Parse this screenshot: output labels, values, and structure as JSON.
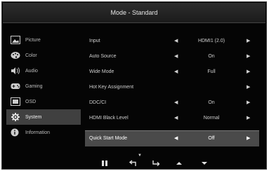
{
  "title": "Mode - Standard",
  "sidebar": {
    "items": [
      {
        "label": "Picture",
        "icon": "picture-icon"
      },
      {
        "label": "Color",
        "icon": "palette-icon"
      },
      {
        "label": "Audio",
        "icon": "speaker-icon"
      },
      {
        "label": "Gaming",
        "icon": "gamepad-icon"
      },
      {
        "label": "OSD",
        "icon": "osd-icon"
      },
      {
        "label": "System",
        "icon": "gear-icon"
      },
      {
        "label": "Information",
        "icon": "info-icon"
      }
    ],
    "active": "System"
  },
  "settings": [
    {
      "label": "Input",
      "value": "HDMI1 (2.0)"
    },
    {
      "label": "Auto Source",
      "value": "On"
    },
    {
      "label": "Wide Mode",
      "value": "Full"
    },
    {
      "label": "Hot Key Assignment",
      "value": ""
    },
    {
      "label": "DDC/CI",
      "value": "On"
    },
    {
      "label": "HDMI Black Level",
      "value": "Normal"
    },
    {
      "label": "Quick Start Mode",
      "value": "Off"
    }
  ],
  "glyphs": {
    "left": "◀",
    "right": "▶",
    "more_down": "▼"
  },
  "colors": {
    "background": "#050505",
    "highlight": "#4a4a4a",
    "active_sidebar": "#404040"
  }
}
